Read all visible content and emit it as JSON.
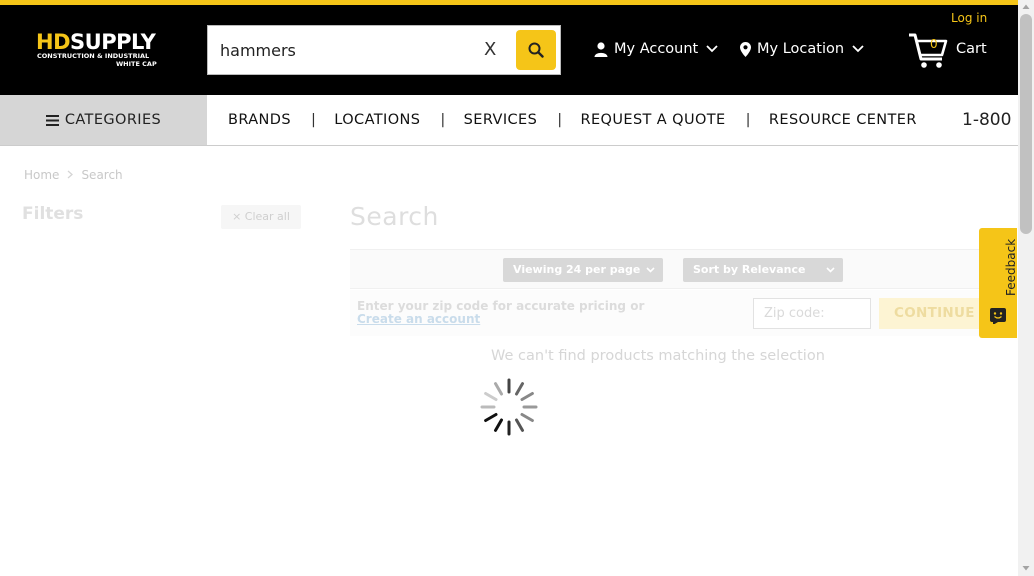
{
  "header": {
    "logo": {
      "part1": "HD",
      "part2": "SUPPLY",
      "sub1": "CONSTRUCTION & INDUSTRIAL",
      "sub2": "WHITE CAP"
    },
    "search": {
      "value": "hammers",
      "clear_label": "X",
      "icon": "search-icon"
    },
    "account_label": "My Account",
    "location_label": "My Location",
    "login_label": "Log in",
    "cart": {
      "count": "0",
      "label": "Cart"
    },
    "accent_color": "#f5c518"
  },
  "nav": {
    "categories_label": "CATEGORIES",
    "items": [
      "BRANDS",
      "LOCATIONS",
      "SERVICES",
      "REQUEST A QUOTE",
      "RESOURCE CENTER"
    ],
    "separator": "|",
    "phone": "1-800"
  },
  "breadcrumb": {
    "home": "Home",
    "current": "Search"
  },
  "filters": {
    "title": "Filters",
    "clear_all": "Clear all",
    "clear_icon": "×"
  },
  "main": {
    "title": "Search",
    "view_select": "Viewing 24 per page",
    "sort_select": "Sort by Relevance",
    "zip": {
      "message": "Enter your zip code for accurate pricing or",
      "link": "Create an account",
      "placeholder": "Zip code:",
      "continue_label": "CONTINUE"
    },
    "empty_message": "We can't find products matching the selection",
    "loading": true
  },
  "feedback": {
    "label": "Feedback"
  }
}
